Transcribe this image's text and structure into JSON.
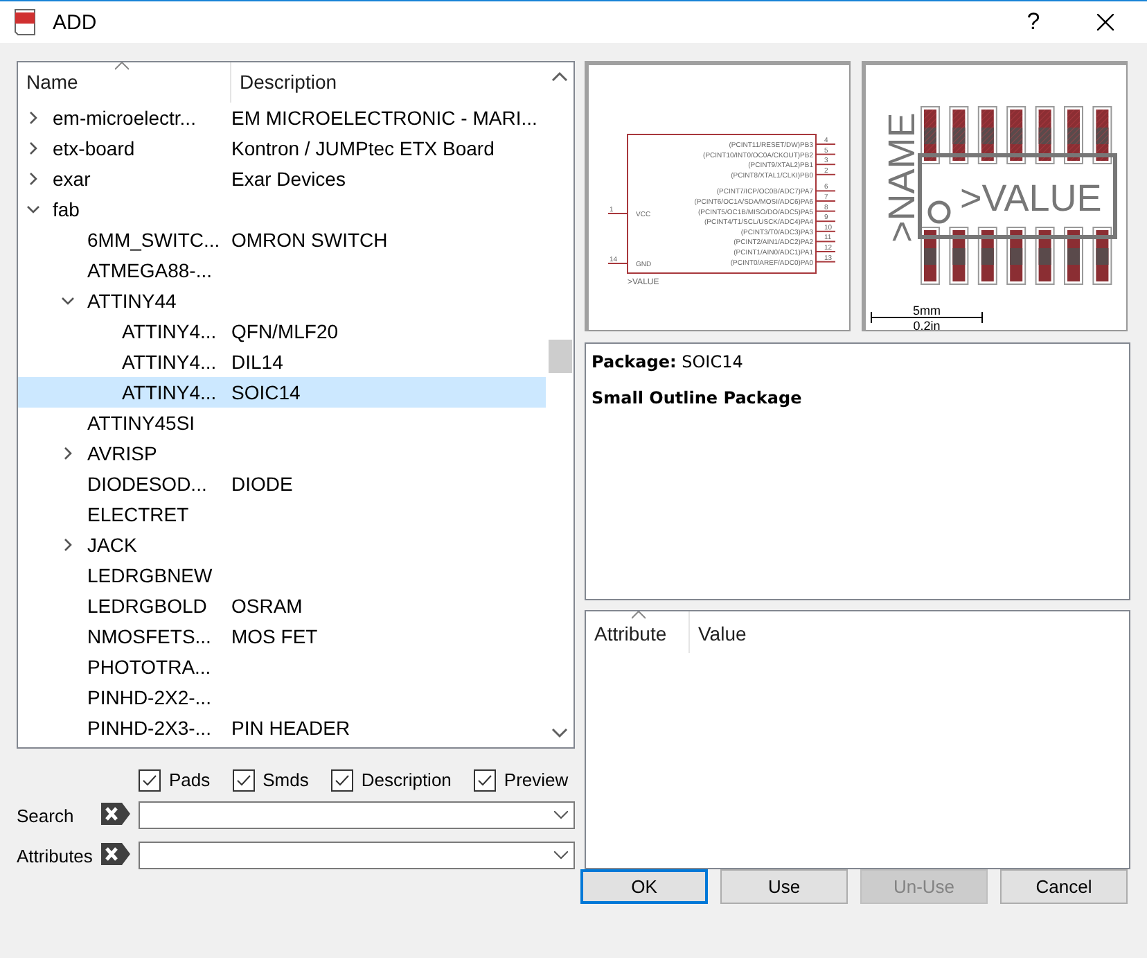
{
  "window": {
    "title": "ADD",
    "help": "?"
  },
  "tree": {
    "columns": [
      "Name",
      "Description"
    ],
    "items": [
      {
        "name": "em-microelectr...",
        "description": "EM MICROELECTRONIC - MARI...",
        "expanded": false,
        "selected": false
      },
      {
        "name": "etx-board",
        "description": "Kontron / JUMPtec ETX Board",
        "expanded": false,
        "selected": false
      },
      {
        "name": "exar",
        "description": "Exar Devices",
        "expanded": false,
        "selected": false
      },
      {
        "name": "fab",
        "expanded": true,
        "selected": false,
        "children": [
          {
            "name": "6MM_SWITC...",
            "description": "OMRON SWITCH",
            "selected": false
          },
          {
            "name": "ATMEGA88-...",
            "selected": false
          },
          {
            "name": "ATTINY44",
            "expanded": true,
            "selected": false,
            "children": [
              {
                "name": "ATTINY4...",
                "description": "QFN/MLF20",
                "selected": false
              },
              {
                "name": "ATTINY4...",
                "description": "DIL14",
                "selected": false
              },
              {
                "name": "ATTINY4...",
                "description": "SOIC14",
                "selected": true
              }
            ]
          },
          {
            "name": "ATTINY45SI",
            "selected": false
          },
          {
            "name": "AVRISP",
            "expanded": false,
            "selected": false
          },
          {
            "name": "DIODESOD...",
            "description": "DIODE",
            "selected": false
          },
          {
            "name": "ELECTRET",
            "selected": false
          },
          {
            "name": "JACK",
            "expanded": false,
            "selected": false
          },
          {
            "name": "LEDRGBNEW",
            "selected": false
          },
          {
            "name": "LEDRGBOLD",
            "description": "OSRAM",
            "selected": false
          },
          {
            "name": "NMOSFETS...",
            "description": "MOS FET",
            "selected": false
          },
          {
            "name": "PHOTOTRA...",
            "selected": false
          },
          {
            "name": "PINHD-2X2-...",
            "selected": false
          },
          {
            "name": "PINHD-2X3-...",
            "description": "PIN HEADER",
            "selected": false
          }
        ]
      }
    ]
  },
  "symbol": {
    "pins_right": [
      {
        "label": "(PCINT11/RESET/DW)PB3",
        "number": "4"
      },
      {
        "label": "(PCINT10/INT0/OC0A/CKOUT)PB2",
        "number": "5"
      },
      {
        "label": "(PCINT9/XTAL2)PB1",
        "number": "3"
      },
      {
        "label": "(PCINT8/XTAL1/CLKI)PB0",
        "number": "2"
      },
      {
        "label": "(PCINT7/ICP/OC0B/ADC7)PA7",
        "number": "6"
      },
      {
        "label": "(PCINT6/OC1A/SDA/MOSI/ADC6)PA6",
        "number": "7"
      },
      {
        "label": "(PCINT5/OC1B/MISO/DO/ADC5)PA5",
        "number": "8"
      },
      {
        "label": "(PCINT4/T1/SCL/USCK/ADC4)PA4",
        "number": "9"
      },
      {
        "label": "(PCINT3/T0/ADC3)PA3",
        "number": "10"
      },
      {
        "label": "(PCINT2/AIN1/ADC2)PA2",
        "number": "11"
      },
      {
        "label": "(PCINT1/AIN0/ADC1)PA1",
        "number": "12"
      },
      {
        "label": "(PCINT0/AREF/ADC0)PA0",
        "number": "13"
      }
    ],
    "pins_left": [
      {
        "label": "VCC",
        "number": "1"
      },
      {
        "label": "GND",
        "number": "14"
      }
    ],
    "value": ">VALUE"
  },
  "footprint": {
    "name": ">NAME",
    "value": ">VALUE",
    "scale_metric": "5mm",
    "scale_imperial": "0.2in"
  },
  "package": {
    "title": "**Package:** SOIC14",
    "description": "Small Outline Package"
  },
  "attributes": {
    "columns": [
      "Attribute",
      "Value"
    ]
  },
  "filters": [
    {
      "label": "Pads",
      "checked": true
    },
    {
      "label": "Smds",
      "checked": true
    },
    {
      "label": "Description",
      "checked": true
    },
    {
      "label": "Preview",
      "checked": true
    }
  ],
  "search": {
    "label": "Search"
  },
  "attribute_filter": {
    "label": "Attributes"
  },
  "buttons": [
    {
      "label": "OK",
      "default": true,
      "disabled": false
    },
    {
      "label": "Use",
      "default": false,
      "disabled": false
    },
    {
      "label": "Un-Use",
      "default": false,
      "disabled": true
    },
    {
      "label": "Cancel",
      "default": false,
      "disabled": false
    }
  ]
}
